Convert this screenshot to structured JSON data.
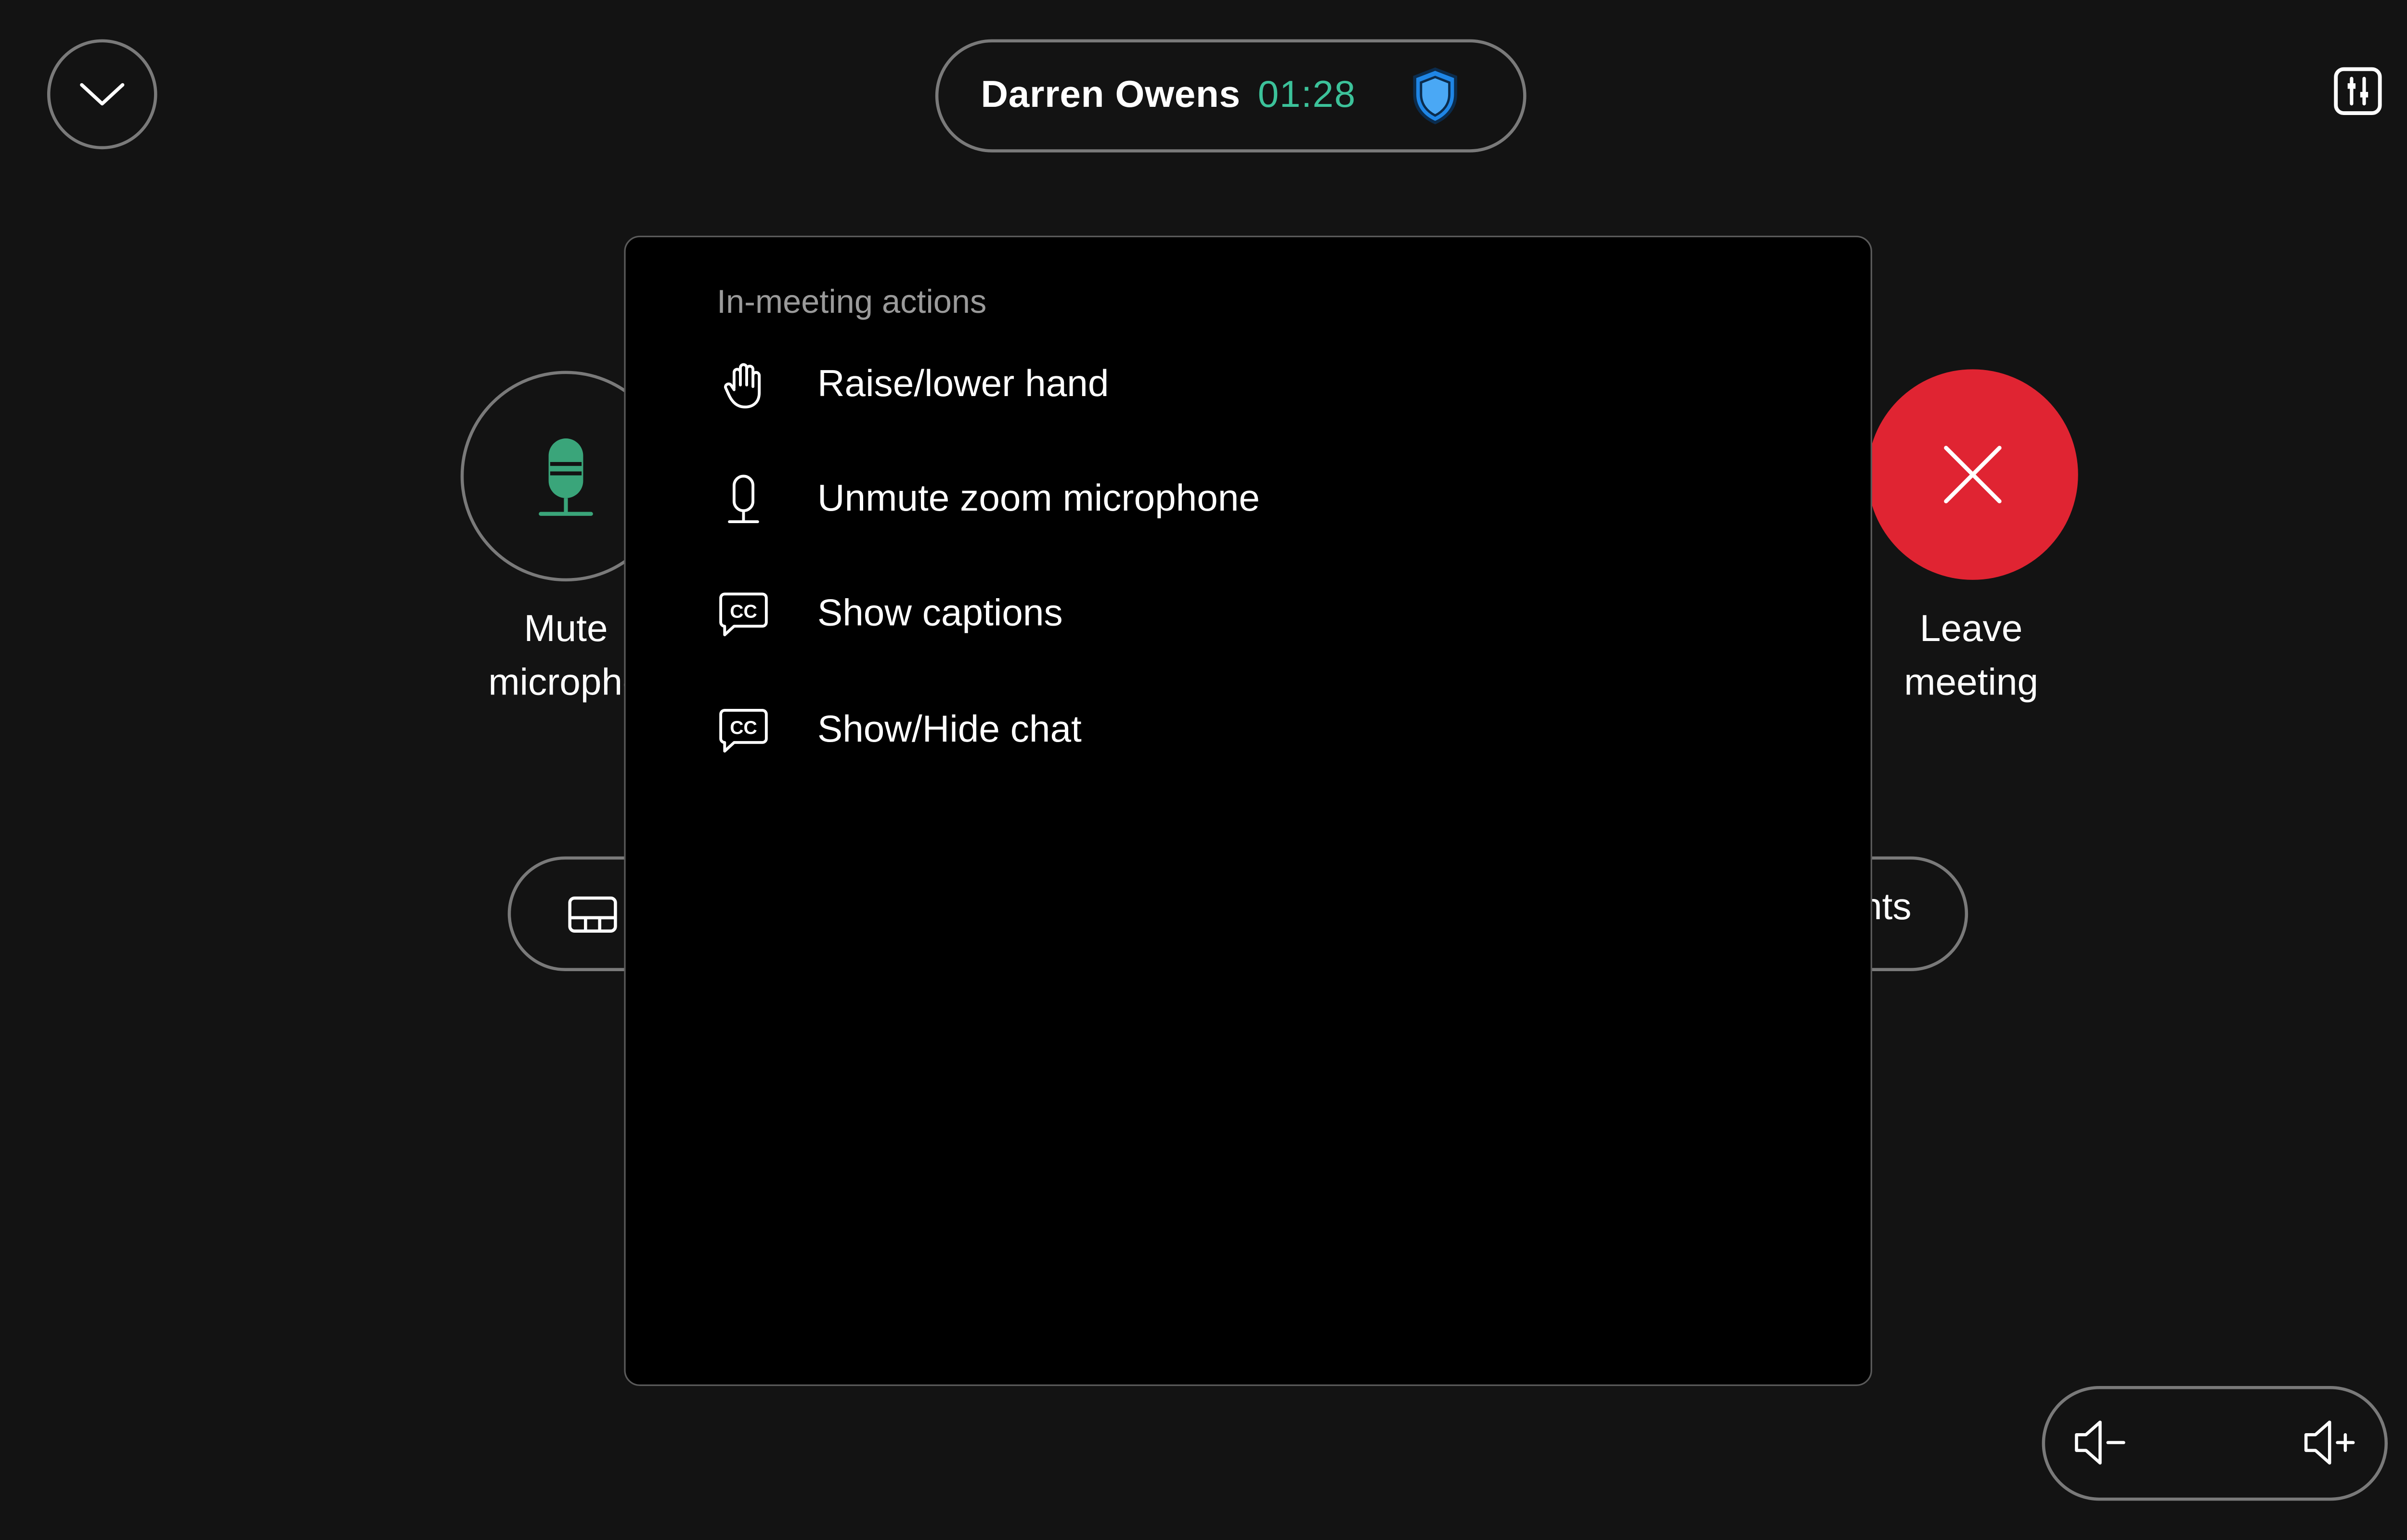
{
  "header": {
    "caller_name": "Darren Owens",
    "call_timer": "01:28"
  },
  "controls": {
    "mute_label_line1": "Mute",
    "mute_label_line2": "micropho",
    "leave_label_line1": "Leave",
    "leave_label_line2": "meeting",
    "participants_partial": "nts"
  },
  "menu": {
    "heading": "In-meeting actions",
    "items": [
      {
        "label": "Raise/lower hand",
        "icon": "hand-icon"
      },
      {
        "label": "Unmute zoom microphone",
        "icon": "microphone-icon"
      },
      {
        "label": "Show captions",
        "icon": "captions-icon"
      },
      {
        "label": "Show/Hide chat",
        "icon": "chat-icon"
      }
    ]
  },
  "icons": {
    "collapse": "chevron-down-icon",
    "security": "shield-icon",
    "settings": "settings-sliders-icon",
    "mute": "microphone-icon",
    "leave": "close-icon",
    "layout": "layout-icon",
    "volume_down": "volume-down-icon",
    "volume_up": "volume-up-icon"
  },
  "colors": {
    "background": "#131313",
    "timer_green": "#3cc29a",
    "mic_green": "#3aa57a",
    "shield_blue": "#1f86e6",
    "leave_red": "#e02432",
    "outline_gray": "#7a7a7a",
    "menu_heading_gray": "#9a9a9a"
  }
}
